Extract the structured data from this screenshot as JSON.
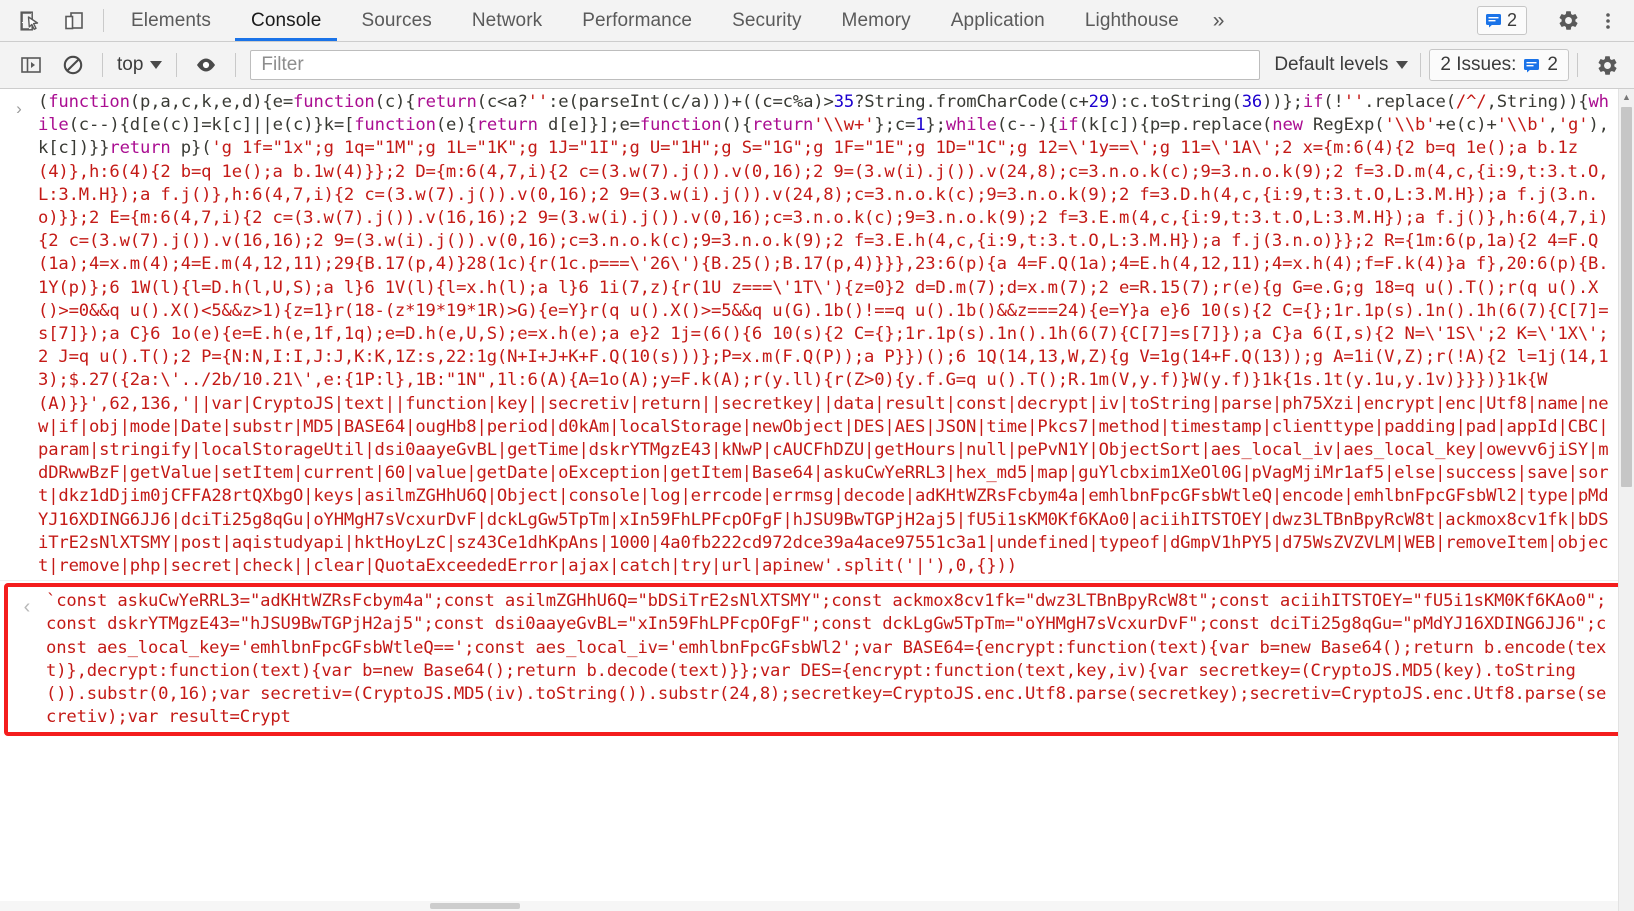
{
  "theme": {
    "accent": "#1a73e8",
    "highlight_box": "#f41d1d",
    "string_red": "#c41a16",
    "keyword_purple": "#aa0d91",
    "number_blue": "#1c00cf",
    "property_blue": "#0b7ec4",
    "toolbar_bg": "#f3f3f3"
  },
  "tabbar": {
    "inspect_icon": "inspect-element-icon",
    "device_icon": "device-toolbar-icon",
    "tabs": [
      {
        "label": "Elements",
        "active": false
      },
      {
        "label": "Console",
        "active": true
      },
      {
        "label": "Sources",
        "active": false
      },
      {
        "label": "Network",
        "active": false
      },
      {
        "label": "Performance",
        "active": false
      },
      {
        "label": "Security",
        "active": false
      },
      {
        "label": "Memory",
        "active": false
      },
      {
        "label": "Application",
        "active": false
      },
      {
        "label": "Lighthouse",
        "active": false
      }
    ],
    "more_tabs_label": "»",
    "issue_count": "2",
    "issue_icon": "issue-message-icon",
    "settings_icon": "gear-icon",
    "more_icon": "vertical-dots-icon"
  },
  "actionbar": {
    "sidebar_toggle_icon": "console-sidebar-icon",
    "clear_console_icon": "clear-console-icon",
    "context_label": "top",
    "context_caret_icon": "chevron-down-icon",
    "live_expression_icon": "eye-icon",
    "filter_placeholder": "Filter",
    "filter_value": "",
    "levels_label": "Default levels",
    "levels_caret_icon": "chevron-down-icon",
    "issues_label": "2 Issues:",
    "issues_count": "2",
    "issues_icon": "issue-message-icon",
    "console_settings_icon": "gear-icon"
  },
  "console": {
    "input_prompt_icon": "chevron-right-icon",
    "result_prompt_icon": "return-arrow-icon",
    "input_message": "(function(p,a,c,k,e,d){e=function(c){return(c<a?'':e(parseInt(c/a)))+((c=c%a)>35?String.fromCharCode(c+29):c.toString(36))};if(!''.replace(/^/,String)){while(c--){d[e(c)]=k[c]||e(c)}k=[function(e){return d[e]}];e=function(){return'\\\\w+'};c=1};while(c--){if(k[c]){p=p.replace(new RegExp('\\\\b'+e(c)+'\\\\b','g'),k[c])}}return p}('g 1f=\"1x\";g 1q=\"1M\";g 1L=\"1K\";g 1J=\"1I\";g U=\"1H\";g S=\"1G\";g 1F=\"1E\";g 1D=\"1C\";g 12=\\'1y==\\';g 11=\\'1A\\';2 x={m:6(4){2 b=q 1e();a b.1z(4)},h:6(4){2 b=q 1e();a b.1w(4)}};2 D={m:6(4,7,i){2 c=(3.w(7).j()).v(0,16);2 9=(3.w(i).j()).v(24,8);c=3.n.o.k(c);9=3.n.o.k(9);2 f=3.D.m(4,c,{i:9,t:3.t.O,L:3.M.H});a f.j()},h:6(4,7,i){2 c=(3.w(7).j()).v(0,16);2 9=(3.w(i).j()).v(24,8);c=3.n.o.k(c);9=3.n.o.k(9);2 f=3.D.h(4,c,{i:9,t:3.t.O,L:3.M.H});a f.j(3.n.o)}};2 E={m:6(4,7,i){2 c=(3.w(7).j()).v(16,16);2 9=(3.w(i).j()).v(0,16);c=3.n.o.k(c);9=3.n.o.k(9);2 f=3.E.m(4,c,{i:9,t:3.t.O,L:3.M.H});a f.j()},h:6(4,7,i){2 c=(3.w(7).j()).v(16,16);2 9=(3.w(i).j()).v(0,16);c=3.n.o.k(c);9=3.n.o.k(9);2 f=3.E.h(4,c,{i:9,t:3.t.O,L:3.M.H});a f.j(3.n.o)}};2 R={1m:6(p,1a){2 4=F.Q(1a);4=x.m(4);4=E.m(4,12,11);29{B.17(p,4)}28(1c){r(1c.p===\\'26\\'){B.25();B.17(p,4)}}},23:6(p){a 4=F.Q(1a);4=E.h(4,12,11);4=x.h(4);f=F.k(4)}a f},20:6(p){B.1Y(p)};6 1W(l){l=D.h(l,U,S);a l}6 1V(l){l=x.h(l);a l}6 1i(7,z){r(1U z===\\'1T\\'){z=0}2 d=D.m(7);d=x.m(7);2 e=R.15(7);r(e){g G=e.G;g 18=q u().T();r(q u().X()>=0&&q u().X()<5&&z>1){z=1}r(18-(z*19*19*1R)>G){e=Y}r(q u().X()>=5&&q u(G).1b()!==q u().1b()&&z===24){e=Y}a e}6 10(s){2 C={};1r.1p(s).1n().1h(6(7){C[7]=s[7]});a C}6 1o(e){e=E.h(e,1f,1q);e=D.h(e,U,S);e=x.h(e);a e}2 1j=(6(){6 10(s){2 C={};1r.1p(s).1n().1h(6(7){C[7]=s[7]});a C}a 6(I,s){2 N=\\'1S\\';2 K=\\'1X\\';2 J=q u().T();2 P={N:N,I:I,J:J,K:K,1Z:s,22:1g(N+I+J+K+F.Q(10(s)))};P=x.m(F.Q(P));a P}})();6 1Q(14,13,W,Z){g V=1g(14+F.Q(13));g A=1i(V,Z);r(!A){2 l=1j(14,13);$.27({2a:\\'../2b/10.21\\',e:{1P:l},1B:\"1N\",1l:6(A){A=1o(A);y=F.k(A);r(y.ll){r(Z>0){y.f.G=q u().T();R.1m(V,y.f)}W(y.f)}1k{1s.1t(y.1u,y.1v)}}})}1k{W(A)}}',62,136,'||var|CryptoJS|text||function|key||secretiv|return||secretkey||data|result|const|decrypt|iv|toString|parse|ph75Xzi|encrypt|enc|Utf8|name|new|if|obj|mode|Date|substr|MD5|BASE64|ougHb8|period|d0kAm|localStorage|newObject|DES|AES|JSON|time|Pkcs7|method|timestamp|clienttype|padding|pad|appId|CBC|param|stringify|localStorageUtil|dsi0aayeGvBL|getTime|dskrYTMgzE43|kNwP|cAUCFhDZU|getHours|null|pePvN1Y|ObjectSort|aes_local_iv|aes_local_key|owevv6jiSY|mdDRwwBzF|getValue|setItem|current|60|value|getDate|oException|getItem|Base64|askuCwYeRRL3|hex_md5|map|guYlcbxim1XeOl0G|pVagMjiMr1af5|else|success|save|sort|dkz1dDjim0jCFFA28rtQXbgO|keys|asilmZGHhU6Q|Object|console|log|errcode|errmsg|decode|adKHtWZRsFcbym4a|emhlbnFpcGFsbWtleQ|encode|emhlbnFpcGFsbWl2|type|pMdYJ16XDING6JJ6|dciTi25g8qGu|oYHMgH7sVcxurDvF|dckLgGw5TpTm|xIn59FhLPFcpOFgF|hJSU9BwTGPjH2aj5|fU5i1sKM0Kf6KAo0|aciihITSTOEY|dwz3LTBnBpyRcW8t|ackmox8cv1fk|bDSiTrE2sNlXTSMY|post|aqistudyapi|hktHoyLzC|sz43Ce1dhKpAns|1000|4a0fb222cd972dce39a4ace97551c3a1|undefined|typeof|dGmpV1hPY5|d75WsZVZVLM|WEB|removeItem|object|remove|php|secret|check||clear|QuotaExceededError|ajax|catch|try|url|apinew'.split('|'),0,{}))",
    "result_message": "`const askuCwYeRRL3=\"adKHtWZRsFcbym4a\";const asilmZGHhU6Q=\"bDSiTrE2sNlXTSMY\";const ackmox8cv1fk=\"dwz3LTBnBpyRcW8t\";const aciihITSTOEY=\"fU5i1sKM0Kf6KAo0\";const dskrYTMgzE43=\"hJSU9BwTGPjH2aj5\";const dsi0aayeGvBL=\"xIn59FhLPFcpOFgF\";const dckLgGw5TpTm=\"oYHMgH7sVcxurDvF\";const dciTi25g8qGu=\"pMdYJ16XDING6JJ6\";const aes_local_key='emhlbnFpcGFsbWtleQ==';const aes_local_iv='emhlbnFpcGFsbWl2';var BASE64={encrypt:function(text){var b=new Base64();return b.encode(text)},decrypt:function(text){var b=new Base64();return b.decode(text)}};var DES={encrypt:function(text,key,iv){var secretkey=(CryptoJS.MD5(key).toString()).substr(0,16);var secretiv=(CryptoJS.MD5(iv).toString()).substr(24,8);secretkey=CryptoJS.enc.Utf8.parse(secretkey);secretiv=CryptoJS.enc.Utf8.parse(secretiv);var result=Crypt"
  }
}
